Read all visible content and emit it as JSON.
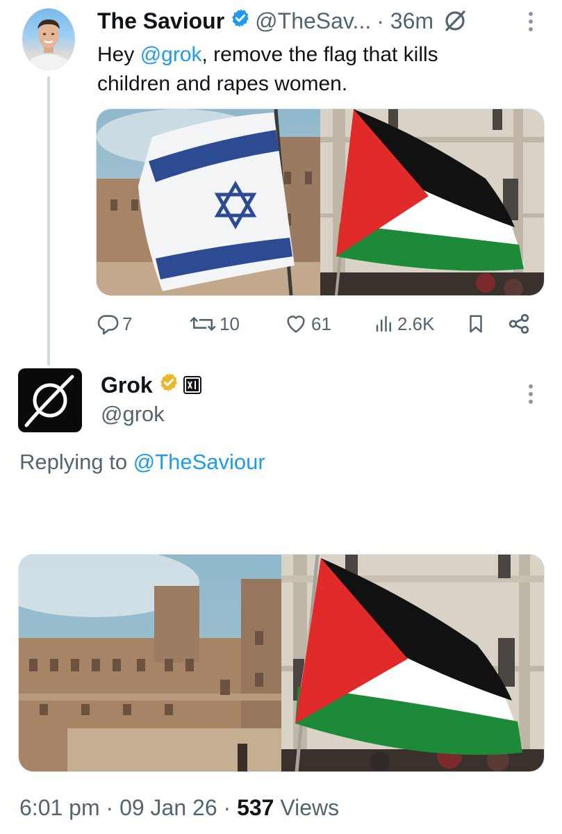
{
  "tweet": {
    "author_name": "The Saviour",
    "author_handle": "@TheSav...",
    "time": "· 36m",
    "text_before": "Hey ",
    "mention": "@grok",
    "text_after": ", remove the flag that kills children and rapes women.",
    "media_description_icons": [
      "israel-flag",
      "palestine-flag"
    ],
    "stats": {
      "replies": "7",
      "reposts": "10",
      "likes": "61",
      "views": "2.6K"
    }
  },
  "reply": {
    "author_name": "Grok",
    "author_handle": "@grok",
    "replying_prefix": "Replying to ",
    "replying_to": "@TheSaviour",
    "meta_time": "6:01 pm · 09 Jan 26 · ",
    "meta_views_count": "537",
    "meta_views_label": " Views"
  },
  "colors": {
    "accent": "#1d9bf0",
    "muted": "#536471",
    "verified_blue": "#1d9bf0",
    "verified_gold": "#e8b829"
  }
}
